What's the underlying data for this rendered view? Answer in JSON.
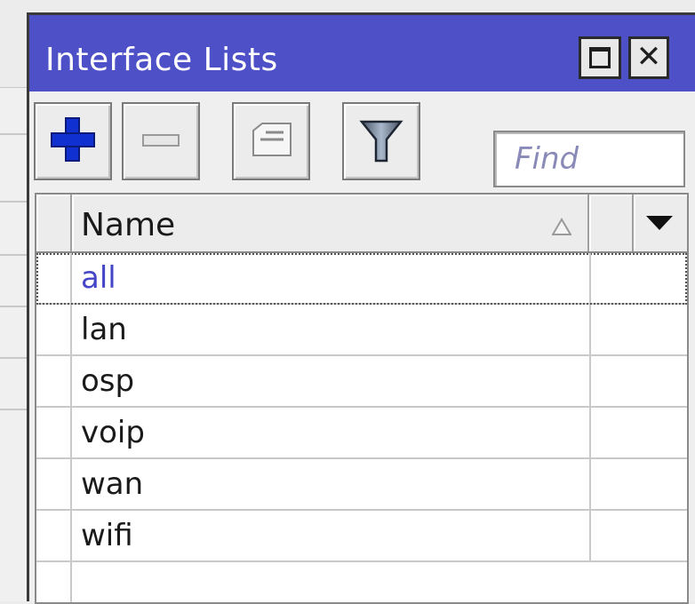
{
  "window": {
    "title": "Interface Lists"
  },
  "toolbar": {
    "add_icon": "plus-icon",
    "remove_icon": "minus-icon",
    "comment_icon": "comment-icon",
    "filter_icon": "filter-icon",
    "find_placeholder": "Find"
  },
  "table": {
    "columns": {
      "name": "Name"
    },
    "rows": [
      {
        "name": "all"
      },
      {
        "name": "lan"
      },
      {
        "name": "osp"
      },
      {
        "name": "voip"
      },
      {
        "name": "wan"
      },
      {
        "name": "wifi"
      }
    ]
  },
  "colors": {
    "titlebar": "#4e50c8",
    "focused_text": "#4545c8",
    "add_icon": "#1030d0"
  }
}
